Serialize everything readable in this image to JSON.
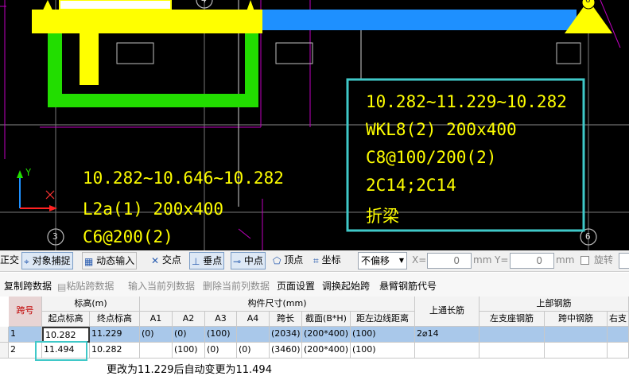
{
  "cad": {
    "beam1": {
      "elevation": "10.282~11.229~10.282",
      "name": "WKL8(2) 200x400",
      "stirrup": "C8@100/200(2)",
      "longbars": "2C14;2C14",
      "type": "折梁"
    },
    "beam2": {
      "elevation": "10.282~10.646~10.282",
      "name": "L2a(1) 200x400",
      "stirrup": "C6@200(2)"
    },
    "axis_y": "Y",
    "grid_marks": [
      "3",
      "6",
      "4",
      "6"
    ],
    "colors": {
      "background": "#000000",
      "text": "#ffff00",
      "column": "#22dd00",
      "beam": "#1e90ff",
      "highlight": "#3fc8c8"
    }
  },
  "toolbar": {
    "ortho": "正交",
    "snap": "对象捕捉",
    "dynamic": "动态输入",
    "intersection": "交点",
    "perpendicular": "垂点",
    "midpoint": "中点",
    "vertex": "顶点",
    "coordinate": "坐标",
    "offset_mode": "不偏移",
    "x_label": "X=",
    "x_value": "0",
    "x_unit": "mm",
    "y_label": "Y=",
    "y_value": "0",
    "y_unit": "mm",
    "rotate": "旋转"
  },
  "menu": {
    "copy_span": "复制跨数据",
    "paste_span": "粘贴跨数据",
    "input_column": "输入当前列数据",
    "delete_column": "删除当前列数据",
    "page_setup": "页面设置",
    "adjust_start": "调换起始跨",
    "cantilever": "悬臂钢筋代号"
  },
  "table": {
    "headers": {
      "span": "跨号",
      "elevation_group": "标高(m)",
      "start_elev": "起点标高",
      "end_elev": "终点标高",
      "size_group": "构件尺寸(mm)",
      "a1": "A1",
      "a2": "A2",
      "a3": "A3",
      "a4": "A4",
      "span_length": "跨长",
      "section": "截面(B*H)",
      "edge_dist": "距左边线距离",
      "top_through": "上通长筋",
      "top_rebar_group": "上部钢筋",
      "left_support": "左支座钢筋",
      "mid_span": "跨中钢筋",
      "right_support": "右支"
    },
    "rows": [
      {
        "span": "1",
        "start_elev": "10.282",
        "end_elev": "11.229",
        "a1": "(0)",
        "a2": "(0)",
        "a3": "(100)",
        "a4": "",
        "span_length": "(2034)",
        "section": "(200*400)",
        "edge_dist": "(100)",
        "top_through": "2⌀14",
        "left_support": "",
        "mid_span": "",
        "right_support": ""
      },
      {
        "span": "2",
        "start_elev": "11.494",
        "end_elev": "10.282",
        "a1": "",
        "a2": "(100)",
        "a3": "(0)",
        "a4": "(0)",
        "span_length": "(3460)",
        "section": "(200*400)",
        "edge_dist": "(100)",
        "top_through": "",
        "left_support": "",
        "mid_span": "",
        "right_support": ""
      }
    ]
  },
  "note": "更改为11.229后自动变更为11.494"
}
